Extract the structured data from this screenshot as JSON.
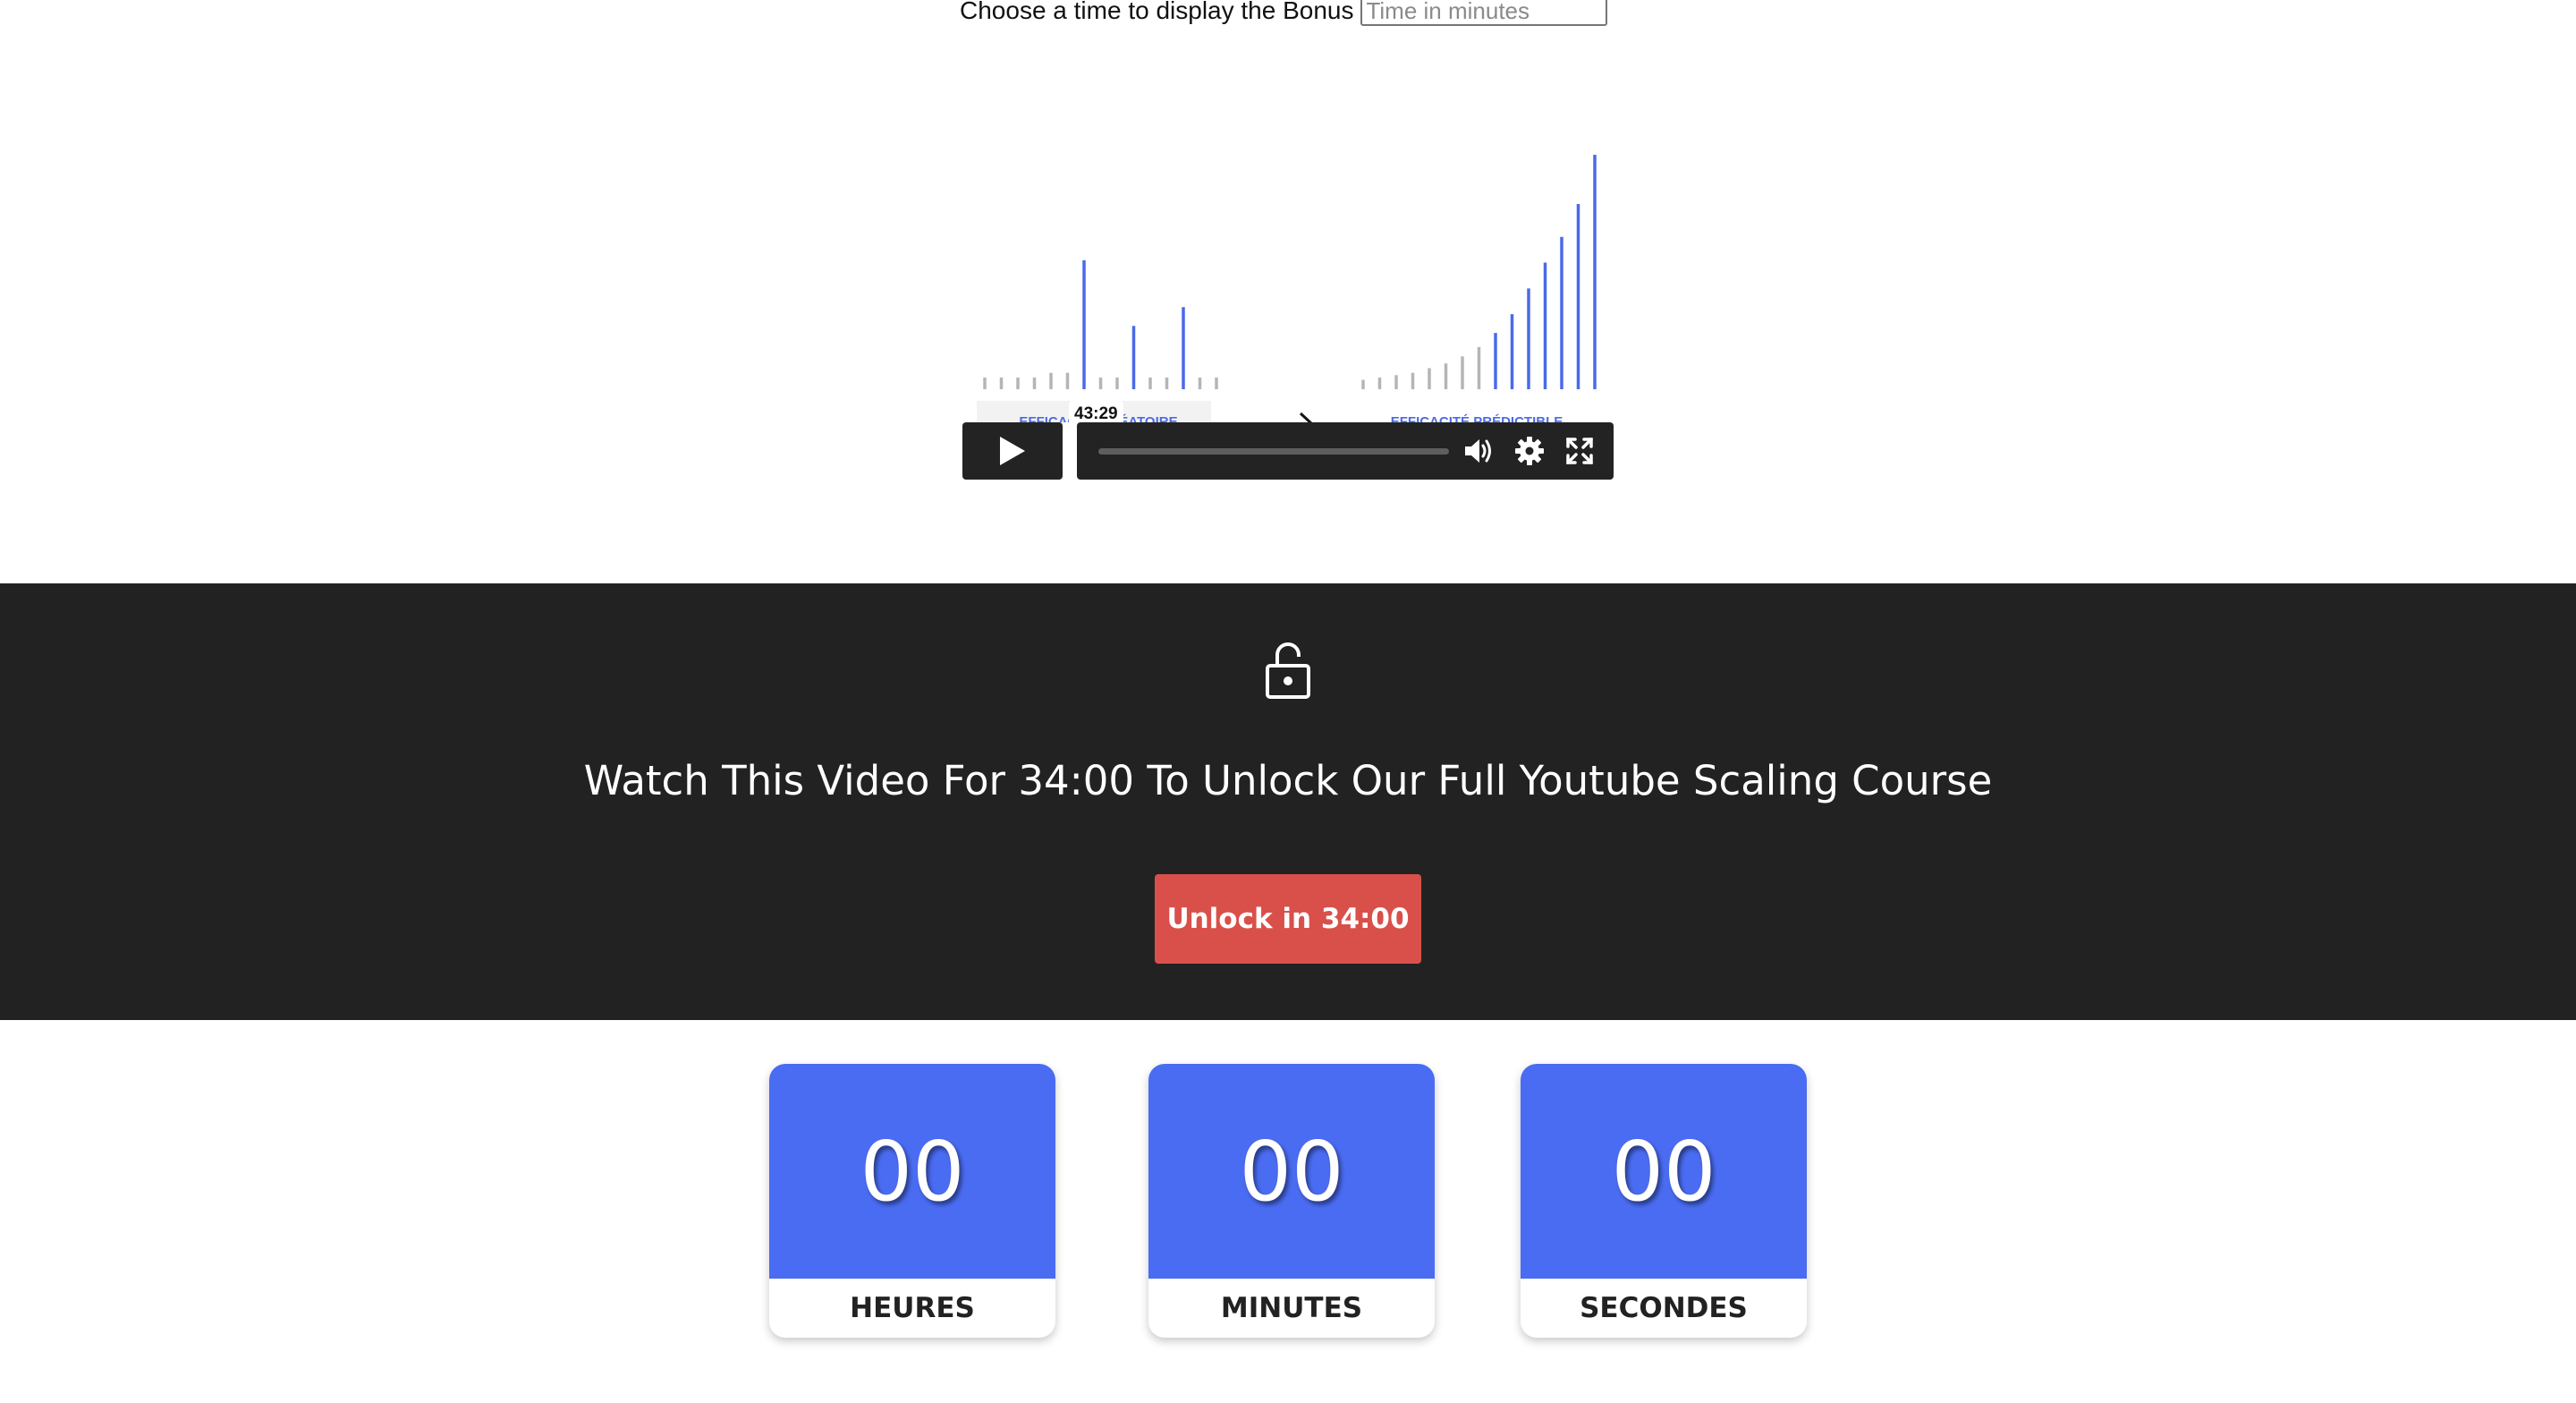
{
  "bonus": {
    "label": "Choose a time to display the Bonus",
    "placeholder": "Time in minutes"
  },
  "video": {
    "thumbnail": {
      "left_caption": "EFFICACITÉ ALÉATOIRE",
      "right_caption": "EFFICACITÉ PRÉDICTIBLE",
      "left_bars": [
        0.05,
        0.05,
        0.05,
        0.05,
        0.07,
        0.07,
        0.55,
        0.05,
        0.05,
        0.27,
        0.05,
        0.05,
        0.35,
        0.05,
        0.05
      ],
      "right_bars": [
        0.04,
        0.05,
        0.06,
        0.07,
        0.09,
        0.11,
        0.14,
        0.18,
        0.24,
        0.32,
        0.43,
        0.54,
        0.65,
        0.79,
        1.0
      ],
      "highlight_color": "#4a6ae8",
      "muted_color": "#b5b5b5"
    },
    "time_tooltip": "43:29",
    "controls": {
      "play_icon": "play-icon",
      "volume_icon": "volume-icon",
      "settings_icon": "gear-icon",
      "fullscreen_icon": "fullscreen-icon"
    }
  },
  "unlock_section": {
    "icon": "unlocked-padlock-icon",
    "headline": "Watch This Video For 34:00 To Unlock Our Full Youtube Scaling Course",
    "button_label": "Unlock in 34:00",
    "background_color": "#222222",
    "button_color": "#d9504a"
  },
  "countdown": {
    "accent_color": "#4a6cf2",
    "hours": {
      "value": "00",
      "label": "HEURES"
    },
    "minutes": {
      "value": "00",
      "label": "MINUTES"
    },
    "seconds": {
      "value": "00",
      "label": "SECONDES"
    }
  }
}
